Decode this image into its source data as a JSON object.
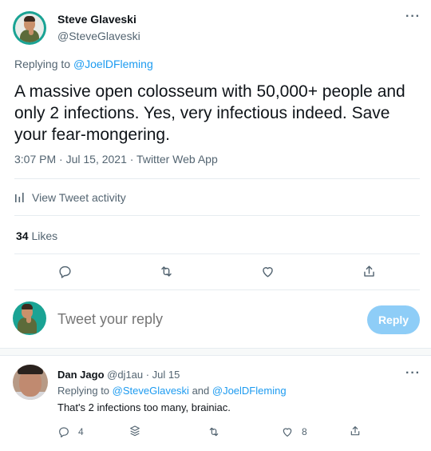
{
  "tweet": {
    "author_name": "Steve Glaveski",
    "author_handle": "@SteveGlaveski",
    "replying_prefix": "Replying to ",
    "replying_to": "@JoelDFleming",
    "text": "A massive open colosseum with 50,000+ people and only 2 infections. Yes, very infectious indeed. Save your fear-mongering.",
    "meta": "3:07 PM · Jul 15, 2021 · Twitter Web App",
    "activity_label": "View Tweet activity",
    "likes_count": "34",
    "likes_label": " Likes",
    "more_label": "···"
  },
  "compose": {
    "placeholder": "Tweet your reply",
    "reply_button": "Reply"
  },
  "reply": {
    "author_name": "Dan Jago",
    "handle_and_time": " @dj1au · Jul 15",
    "replying_prefix": "Replying to ",
    "replying_to_1": "@SteveGlaveski",
    "replying_and": " and ",
    "replying_to_2": "@JoelDFleming",
    "text": "That's 2 infections too many, brainiac.",
    "reply_count": "4",
    "like_count": "8",
    "more_label": "···"
  },
  "colors": {
    "accent": "#1d9bf0",
    "reply_button_disabled": "#8ecdf7",
    "secondary_text": "#536471"
  },
  "icons": [
    "more-icon",
    "activity-icon",
    "reply-icon",
    "retweet-icon",
    "like-icon",
    "share-icon",
    "stack-icon"
  ]
}
